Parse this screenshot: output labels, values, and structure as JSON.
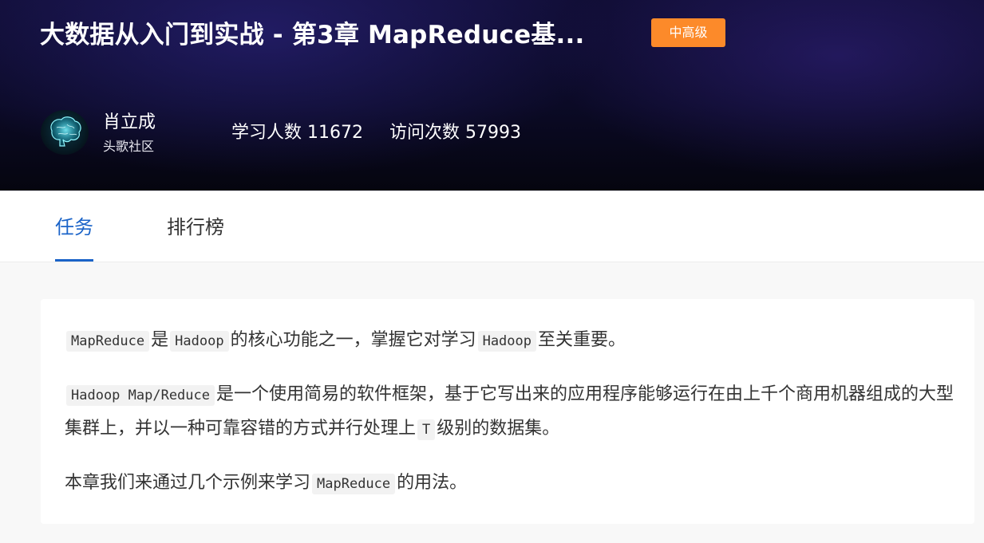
{
  "course": {
    "title": "大数据从入门到实战 - 第3章 MapReduce基...",
    "level": "中高级"
  },
  "author": {
    "name": "肖立成",
    "org": "头歌社区",
    "avatar_icon": "brain-icon"
  },
  "stats": {
    "learners_label": "学习人数",
    "learners_value": "11672",
    "visits_label": "访问次数",
    "visits_value": "57993"
  },
  "tabs": [
    {
      "label": "任务",
      "active": true
    },
    {
      "label": "排行榜",
      "active": false
    }
  ],
  "intro": {
    "p1": [
      "MapReduce",
      "是",
      "Hadoop",
      "的核心功能之一，掌握它对学习",
      "Hadoop",
      "至关重要。"
    ],
    "p2": [
      "Hadoop Map/Reduce",
      "是一个使用简易的软件框架，基于它写出来的应用程序能够运行在由上千个商用机器组成的大型集群上，并以一种可靠容错的方式并行处理上",
      "T",
      "级别的数据集。"
    ],
    "p3": [
      "本章我们来通过几个示例来学习",
      "MapReduce",
      "的用法。"
    ]
  },
  "colors": {
    "accent": "#1a63c8",
    "badge": "#fc8a2a"
  }
}
